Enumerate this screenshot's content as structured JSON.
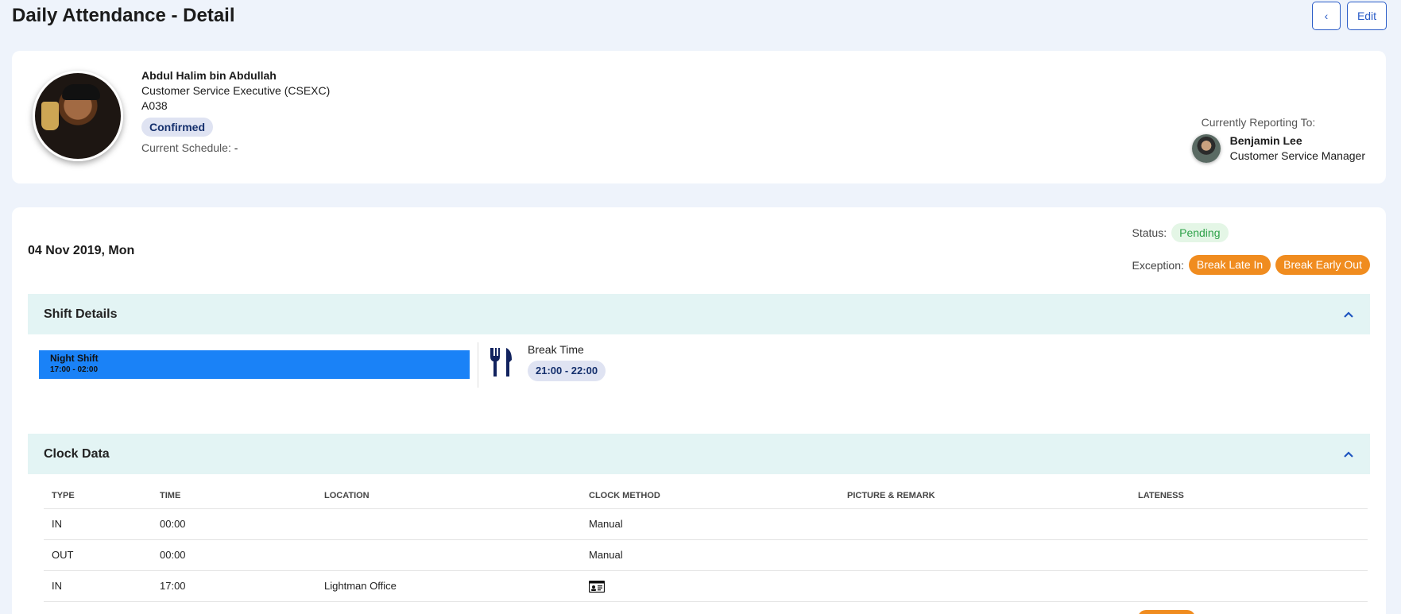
{
  "page": {
    "title": "Daily Attendance - Detail"
  },
  "actions": {
    "back_icon": "chevron-left-icon",
    "edit_label": "Edit"
  },
  "employee": {
    "name": "Abdul Halim bin Abdullah",
    "position": "Customer Service Executive (CSEXC)",
    "id": "A038",
    "status_badge": "Confirmed",
    "schedule_label": "Current Schedule:",
    "schedule_value": "-"
  },
  "reporting": {
    "label": "Currently Reporting To:",
    "name": "Benjamin Lee",
    "role": "Customer Service Manager"
  },
  "attendance": {
    "date": "04 Nov 2019, Mon",
    "status_label": "Status:",
    "status_value": "Pending",
    "exception_label": "Exception:",
    "exceptions": [
      "Break Late In",
      "Break Early Out"
    ]
  },
  "shift_details": {
    "title": "Shift Details",
    "shift_name": "Night Shift",
    "shift_time": "17:00 - 02:00",
    "break_label": "Break Time",
    "break_time": "21:00 - 22:00"
  },
  "clock_data": {
    "title": "Clock Data",
    "columns": [
      "TYPE",
      "TIME",
      "LOCATION",
      "CLOCK METHOD",
      "PICTURE & REMARK",
      "LATENESS"
    ],
    "rows": [
      {
        "type": "IN",
        "time": "00:00",
        "location": "",
        "method": "Manual"
      },
      {
        "type": "OUT",
        "time": "00:00",
        "location": "",
        "method": "Manual"
      },
      {
        "type": "IN",
        "time": "17:00",
        "location": "Lightman Office",
        "method_icon": "id-card-icon"
      }
    ]
  },
  "colors": {
    "accent": "#2a5cc7",
    "shift_bar": "#1a82f7",
    "exception": "#f08c1f",
    "pending": "#2fa24a",
    "section_header_bg": "#e3f4f4"
  }
}
